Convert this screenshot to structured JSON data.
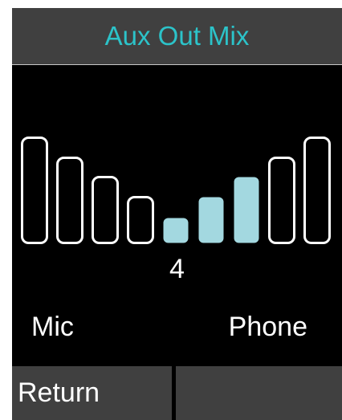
{
  "header": {
    "title": "Aux Out Mix",
    "title_color": "#2cc3c9"
  },
  "mix": {
    "value": "4",
    "left_label": "Mic",
    "right_label": "Phone",
    "active_bars": [
      4,
      5,
      6
    ],
    "active_color": "#a3d8e0"
  },
  "softkeys": {
    "left": "Return",
    "right": ""
  }
}
